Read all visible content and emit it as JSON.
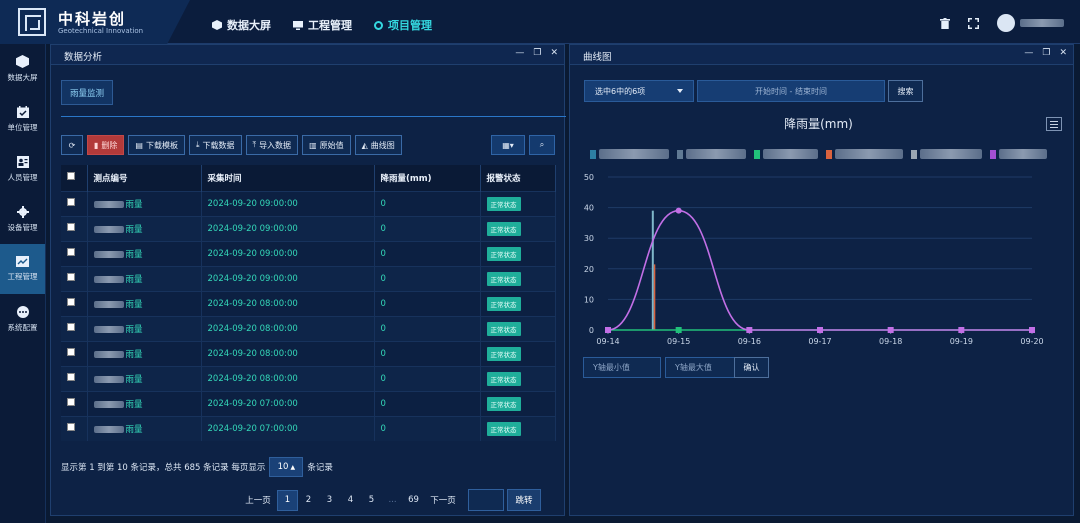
{
  "brand": {
    "title": "中科岩创",
    "subtitle": "Geotechnical Innovation"
  },
  "nav": [
    {
      "label": "数据大屏",
      "icon": "cube-icon"
    },
    {
      "label": "工程管理",
      "icon": "monitor-icon"
    },
    {
      "label": "项目管理",
      "icon": "ring-icon",
      "active": true
    }
  ],
  "header_icons": [
    "trash-icon",
    "fullscreen-icon",
    "avatar"
  ],
  "sidebar": [
    {
      "label": "数据大屏",
      "icon": "cube-icon"
    },
    {
      "label": "单位管理",
      "icon": "calendar-check-icon"
    },
    {
      "label": "人员管理",
      "icon": "person-card-icon"
    },
    {
      "label": "设备管理",
      "icon": "gear-icon"
    },
    {
      "label": "工程管理",
      "icon": "chart-trend-icon",
      "active": true
    },
    {
      "label": "系统配置",
      "icon": "more-dots-icon"
    }
  ],
  "left_panel": {
    "title": "数据分析",
    "tab": "雨量监测",
    "toolbar": {
      "delete": "删除",
      "download_template": "下载模板",
      "download_data": "下载数据",
      "import_data": "导入数据",
      "raw_values": "原始值",
      "curve": "曲线图"
    },
    "columns": [
      "测点编号",
      "采集时间",
      "降雨量(mm)",
      "报警状态"
    ],
    "rows": [
      {
        "point": "雨量",
        "time": "2024-09-20 09:00:00",
        "value": "0",
        "status": "正常状态"
      },
      {
        "point": "雨量",
        "time": "2024-09-20 09:00:00",
        "value": "0",
        "status": "正常状态"
      },
      {
        "point": "雨量",
        "time": "2024-09-20 09:00:00",
        "value": "0",
        "status": "正常状态"
      },
      {
        "point": "雨量",
        "time": "2024-09-20 09:00:00",
        "value": "0",
        "status": "正常状态"
      },
      {
        "point": "雨量",
        "time": "2024-09-20 08:00:00",
        "value": "0",
        "status": "正常状态"
      },
      {
        "point": "雨量",
        "time": "2024-09-20 08:00:00",
        "value": "0",
        "status": "正常状态"
      },
      {
        "point": "雨量",
        "time": "2024-09-20 08:00:00",
        "value": "0",
        "status": "正常状态"
      },
      {
        "point": "雨量",
        "time": "2024-09-20 08:00:00",
        "value": "0",
        "status": "正常状态"
      },
      {
        "point": "雨量",
        "time": "2024-09-20 07:00:00",
        "value": "0",
        "status": "正常状态"
      },
      {
        "point": "雨量",
        "time": "2024-09-20 07:00:00",
        "value": "0",
        "status": "正常状态"
      }
    ],
    "summary_prefix": "显示第 1 到第 10 条记录，总共 685 条记录 每页显示",
    "page_size": "10",
    "summary_suffix": "条记录",
    "pager": {
      "prev": "上一页",
      "pages": [
        "1",
        "2",
        "3",
        "4",
        "5",
        "...",
        "69"
      ],
      "current": "1",
      "next": "下一页",
      "jump": "跳转"
    }
  },
  "right_panel": {
    "title": "曲线图",
    "select_label": "选中6中的6项",
    "date_range_placeholder": "开始时间 - 结束时间",
    "search": "搜索",
    "y_min_placeholder": "Y轴最小值",
    "y_max_placeholder": "Y轴最大值",
    "confirm": "确认"
  },
  "colors": {
    "accent": "#34d8e0",
    "badge": "#1fae9a",
    "danger": "#b23a3a",
    "series_purple": "#c26fe6",
    "series_green": "#21c07a"
  },
  "chart_data": {
    "type": "line",
    "title": "降雨量(mm)",
    "categories": [
      "09-14",
      "09-15",
      "09-16",
      "09-17",
      "09-18",
      "09-19",
      "09-20"
    ],
    "ylim": [
      0,
      50
    ],
    "yticks": [
      0,
      10,
      20,
      30,
      40,
      50
    ],
    "grid": true,
    "legend_position": "top",
    "series": [
      {
        "color": "#c26fe6",
        "values": [
          0,
          39,
          0,
          0,
          0,
          0,
          0
        ]
      },
      {
        "color": "#21c07a",
        "values": [
          0,
          0,
          0,
          0,
          0,
          0,
          0
        ]
      },
      {
        "color": "#7fb7c9",
        "values": [
          0,
          0,
          0,
          0,
          0,
          0,
          0
        ],
        "spike": 39
      }
    ]
  }
}
